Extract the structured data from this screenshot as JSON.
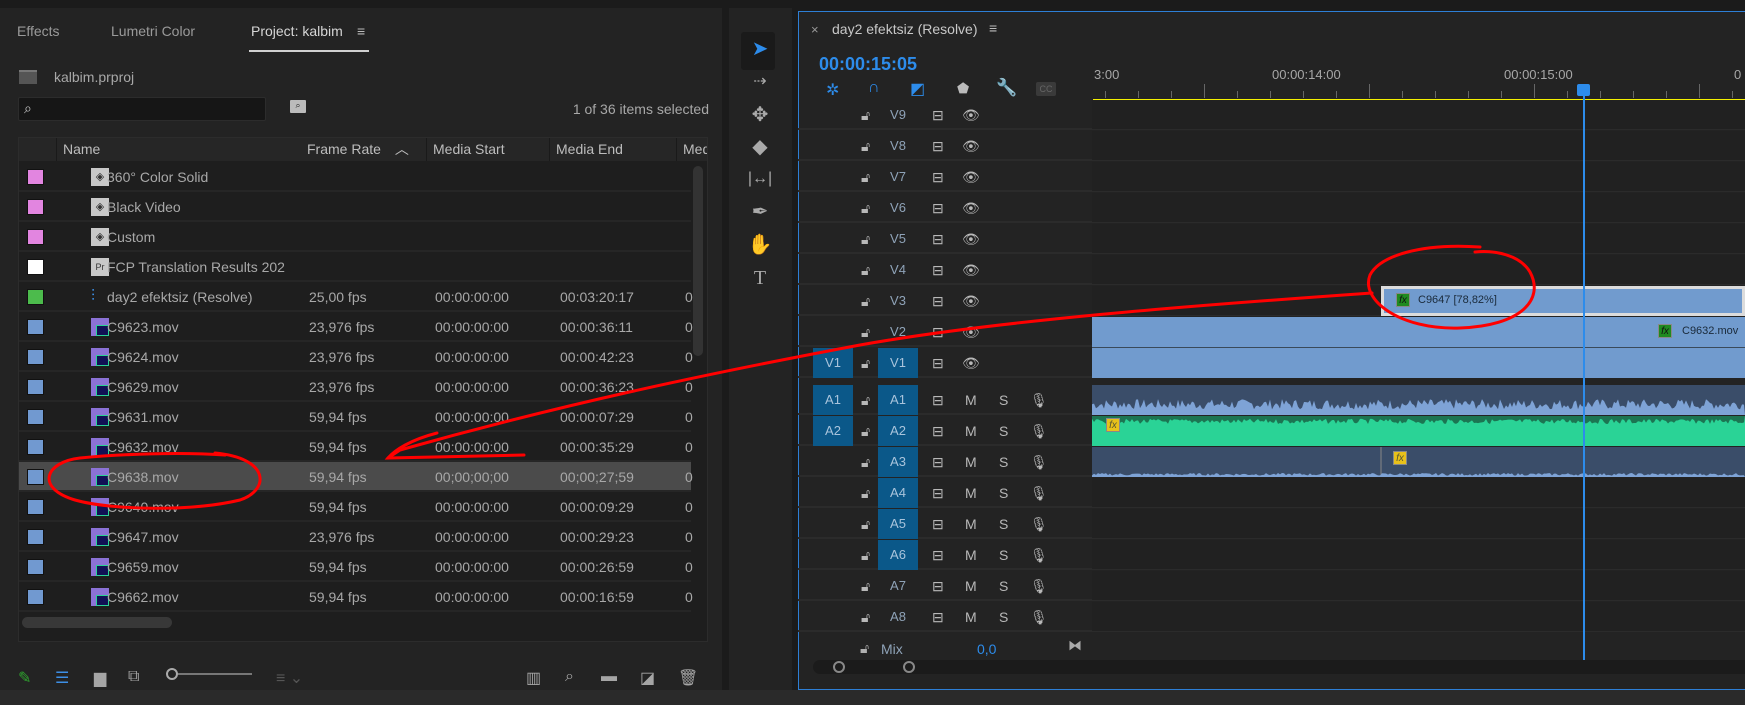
{
  "project_panel": {
    "tabs": [
      {
        "label": "Effects"
      },
      {
        "label": "Lumetri Color"
      },
      {
        "label": "Project: kalbim",
        "active": true
      }
    ],
    "menu_icon": "hamburger-icon",
    "project_file": "kalbim.prproj",
    "search_placeholder": "",
    "selection_count": "1 of 36 items selected",
    "columns": [
      "Name",
      "Frame Rate",
      "Media Start",
      "Media End",
      "Med"
    ],
    "sort_column": "Frame Rate",
    "rows": [
      {
        "color": "#e285e0",
        "icon": "synthetic-icon",
        "name": "360° Color Solid",
        "fps": "",
        "start": "",
        "end": "",
        "more": ""
      },
      {
        "color": "#e285e0",
        "icon": "synthetic-icon",
        "name": "Black Video",
        "fps": "",
        "start": "",
        "end": "",
        "more": ""
      },
      {
        "color": "#e285e0",
        "icon": "synthetic-icon",
        "name": "Custom",
        "fps": "",
        "start": "",
        "end": "",
        "more": ""
      },
      {
        "color": "#ffffff",
        "icon": "premiere-file-icon",
        "name": "FCP Translation Results 202",
        "fps": "",
        "start": "",
        "end": "",
        "more": ""
      },
      {
        "color": "#4cbb4c",
        "icon": "sequence-icon",
        "name": "day2 efektsiz (Resolve)",
        "fps": "25,00 fps",
        "start": "00:00:00:00",
        "end": "00:03:20:17",
        "more": "0"
      },
      {
        "color": "#7199d0",
        "icon": "clip-av-icon",
        "name": "C9623.mov",
        "fps": "23,976 fps",
        "start": "00:00:00:00",
        "end": "00:00:36:11",
        "more": "0"
      },
      {
        "color": "#7199d0",
        "icon": "clip-av-icon",
        "name": "C9624.mov",
        "fps": "23,976 fps",
        "start": "00:00:00:00",
        "end": "00:00:42:23",
        "more": "0"
      },
      {
        "color": "#7199d0",
        "icon": "clip-av-icon",
        "name": "C9629.mov",
        "fps": "23,976 fps",
        "start": "00:00:00:00",
        "end": "00:00:36:23",
        "more": "0"
      },
      {
        "color": "#7199d0",
        "icon": "clip-av-icon",
        "name": "C9631.mov",
        "fps": "59,94 fps",
        "start": "00:00:00:00",
        "end": "00:00:07:29",
        "more": "0"
      },
      {
        "color": "#7199d0",
        "icon": "clip-av-icon",
        "name": "C9632.mov",
        "fps": "59,94 fps",
        "start": "00:00:00:00",
        "end": "00:00:35:29",
        "more": "0"
      },
      {
        "color": "#7199d0",
        "icon": "clip-av-icon",
        "name": "C9638.mov",
        "fps": "59,94 fps",
        "start": "00;00;00;00",
        "end": "00;00;27;59",
        "more": "0",
        "selected": true
      },
      {
        "color": "#7199d0",
        "icon": "clip-av-icon",
        "name": "C9640.mov",
        "fps": "59,94 fps",
        "start": "00:00:00:00",
        "end": "00:00:09:29",
        "more": "0"
      },
      {
        "color": "#7199d0",
        "icon": "clip-av-icon",
        "name": "C9647.mov",
        "fps": "23,976 fps",
        "start": "00:00:00:00",
        "end": "00:00:29:23",
        "more": "0"
      },
      {
        "color": "#7199d0",
        "icon": "clip-av-icon",
        "name": "C9659.mov",
        "fps": "59,94 fps",
        "start": "00:00:00:00",
        "end": "00:00:26:59",
        "more": "0"
      },
      {
        "color": "#7199d0",
        "icon": "clip-av-icon",
        "name": "C9662.mov",
        "fps": "59,94 fps",
        "start": "00:00:00:00",
        "end": "00:00:16:59",
        "more": "0"
      }
    ],
    "bottom_icons": [
      "pencil-icon",
      "list-view-icon",
      "icon-view-icon",
      "freeform-view-icon",
      "zoom-slider",
      "sort-icon",
      "automate-to-sequence-icon",
      "find-icon",
      "new-bin-icon",
      "new-item-icon",
      "trash-icon"
    ]
  },
  "tools": [
    "selection-tool-icon",
    "track-select-tool-icon",
    "ripple-edit-tool-icon",
    "razor-tool-icon",
    "slip-tool-icon",
    "pen-tool-icon",
    "hand-tool-icon",
    "type-tool-icon"
  ],
  "timeline": {
    "close": "×",
    "title": "day2 efektsiz (Resolve)",
    "timecode": "00:00:15:05",
    "ruler_labels": [
      "3:00",
      "00:00:14:00",
      "00:00:15:00",
      "0"
    ],
    "cc": "CC",
    "video_tracks": [
      {
        "label": "V9"
      },
      {
        "label": "V8"
      },
      {
        "label": "V7"
      },
      {
        "label": "V6"
      },
      {
        "label": "V5"
      },
      {
        "label": "V4"
      },
      {
        "label": "V3"
      },
      {
        "label": "V2"
      },
      {
        "label": "V1",
        "source": "V1",
        "targeted": true
      }
    ],
    "audio_tracks": [
      {
        "label": "A1",
        "source": "A1",
        "targeted": true
      },
      {
        "label": "A2",
        "source": "A2",
        "targeted": true
      },
      {
        "label": "A3",
        "targeted": true
      },
      {
        "label": "A4",
        "targeted": true
      },
      {
        "label": "A5",
        "targeted": true
      },
      {
        "label": "A6",
        "targeted": true
      },
      {
        "label": "A7"
      },
      {
        "label": "A8"
      }
    ],
    "mute": "M",
    "solo": "S",
    "mix_label": "Mix",
    "mix_value": "0,0",
    "clips": {
      "v3": "C9647 [78,82%]",
      "v2": "C9632.mov",
      "fx": "fx"
    },
    "accent": "#2d8ceb"
  },
  "annotation_color": "#ff0000"
}
